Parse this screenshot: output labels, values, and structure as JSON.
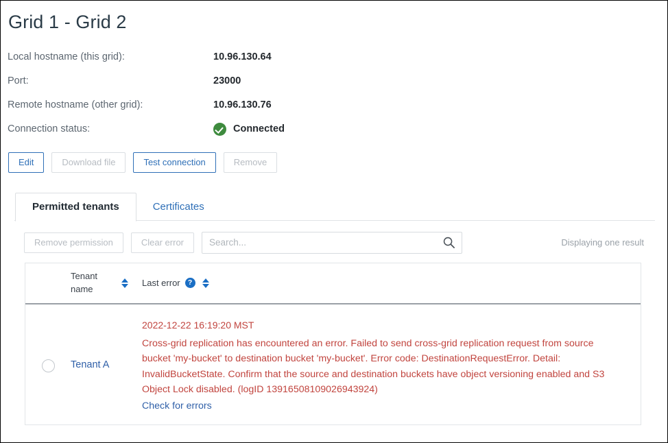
{
  "header": {
    "title": "Grid 1 - Grid 2"
  },
  "details": [
    {
      "label": "Local hostname (this grid):",
      "value": "10.96.130.64"
    },
    {
      "label": "Port:",
      "value": "23000"
    },
    {
      "label": "Remote hostname (other grid):",
      "value": "10.96.130.76"
    }
  ],
  "connection": {
    "label": "Connection status:",
    "value": "Connected",
    "icon": "check-circle-icon",
    "color": "#3e8b3e"
  },
  "actions": [
    {
      "label": "Edit",
      "enabled": true
    },
    {
      "label": "Download file",
      "enabled": false
    },
    {
      "label": "Test connection",
      "enabled": true
    },
    {
      "label": "Remove",
      "enabled": false
    }
  ],
  "tabs": [
    {
      "label": "Permitted tenants",
      "active": true
    },
    {
      "label": "Certificates",
      "active": false
    }
  ],
  "toolbar": {
    "remove_permission_label": "Remove permission",
    "remove_permission_enabled": false,
    "clear_error_label": "Clear error",
    "clear_error_enabled": false,
    "search_placeholder": "Search...",
    "search_value": "",
    "search_icon": "search-icon",
    "result_count": "Displaying one result"
  },
  "table": {
    "columns": [
      {
        "label": "Tenant name",
        "sortable": true,
        "help": false
      },
      {
        "label": "Last error",
        "sortable": true,
        "help": true,
        "help_glyph": "?"
      }
    ],
    "rows": [
      {
        "selected": false,
        "tenant_name": "Tenant A",
        "error_time": "2022-12-22 16:19:20 MST",
        "error_message": "Cross-grid replication has encountered an error. Failed to send cross-grid replication request from source bucket 'my-bucket' to destination bucket 'my-bucket'. Error code: DestinationRequestError. Detail: InvalidBucketState. Confirm that the source and destination buckets have object versioning enabled and S3 Object Lock disabled. (logID 13916508109026943924)",
        "error_link": "Check for errors"
      }
    ]
  },
  "colors": {
    "accent_blue": "#2e6fb7",
    "error_red": "#c1443e",
    "success_green": "#3e8b3e",
    "link_blue": "#3060a8"
  }
}
